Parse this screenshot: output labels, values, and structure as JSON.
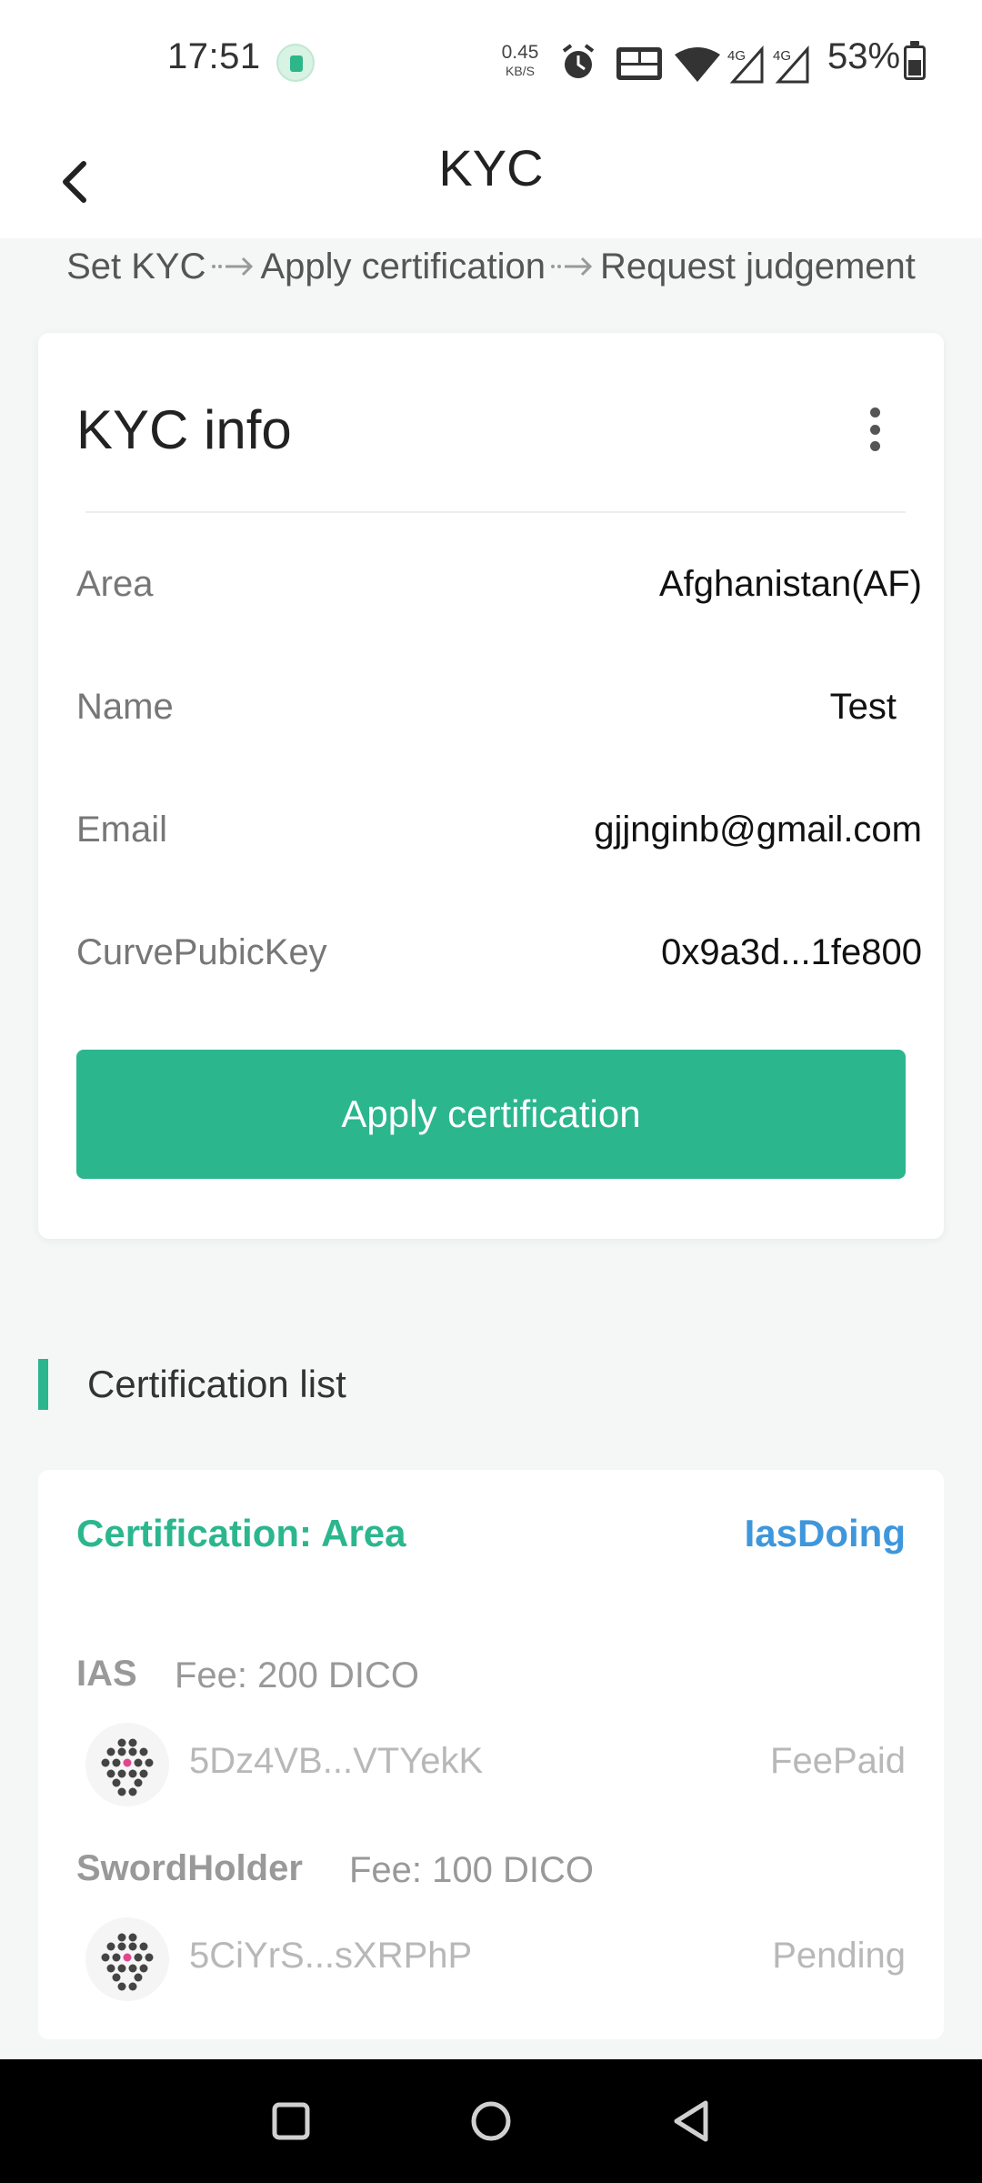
{
  "status_bar": {
    "time": "17:51",
    "net_speed_value": "0.45",
    "net_speed_unit": "KB/S",
    "battery_text": "53%"
  },
  "header": {
    "title": "KYC"
  },
  "steps": [
    "Set KYC",
    "Apply certification",
    "Request judgement"
  ],
  "kyc_info": {
    "title": "KYC info",
    "rows": [
      {
        "label": "Area",
        "value": "Afghanistan(AF)"
      },
      {
        "label": "Name",
        "value": "Test"
      },
      {
        "label": "Email",
        "value": "gjjnginb@gmail.com"
      },
      {
        "label": "CurvePubicKey",
        "value": "0x9a3d...1fe800"
      }
    ],
    "apply_button_label": "Apply certification"
  },
  "certification_list": {
    "title": "Certification list",
    "items": [
      {
        "title": "Certification: Area",
        "status": "IasDoing",
        "registrars": [
          {
            "name": "IAS",
            "fee": "Fee: 200 DICO",
            "address": "5Dz4VB...VTYekK",
            "state": "FeePaid"
          },
          {
            "name": "SwordHolder",
            "fee": "Fee: 100 DICO",
            "address": "5CiYrS...sXRPhP",
            "state": "Pending"
          }
        ]
      }
    ]
  },
  "colors": {
    "accent_green": "#2bb68e",
    "status_blue": "#3e97dc"
  }
}
